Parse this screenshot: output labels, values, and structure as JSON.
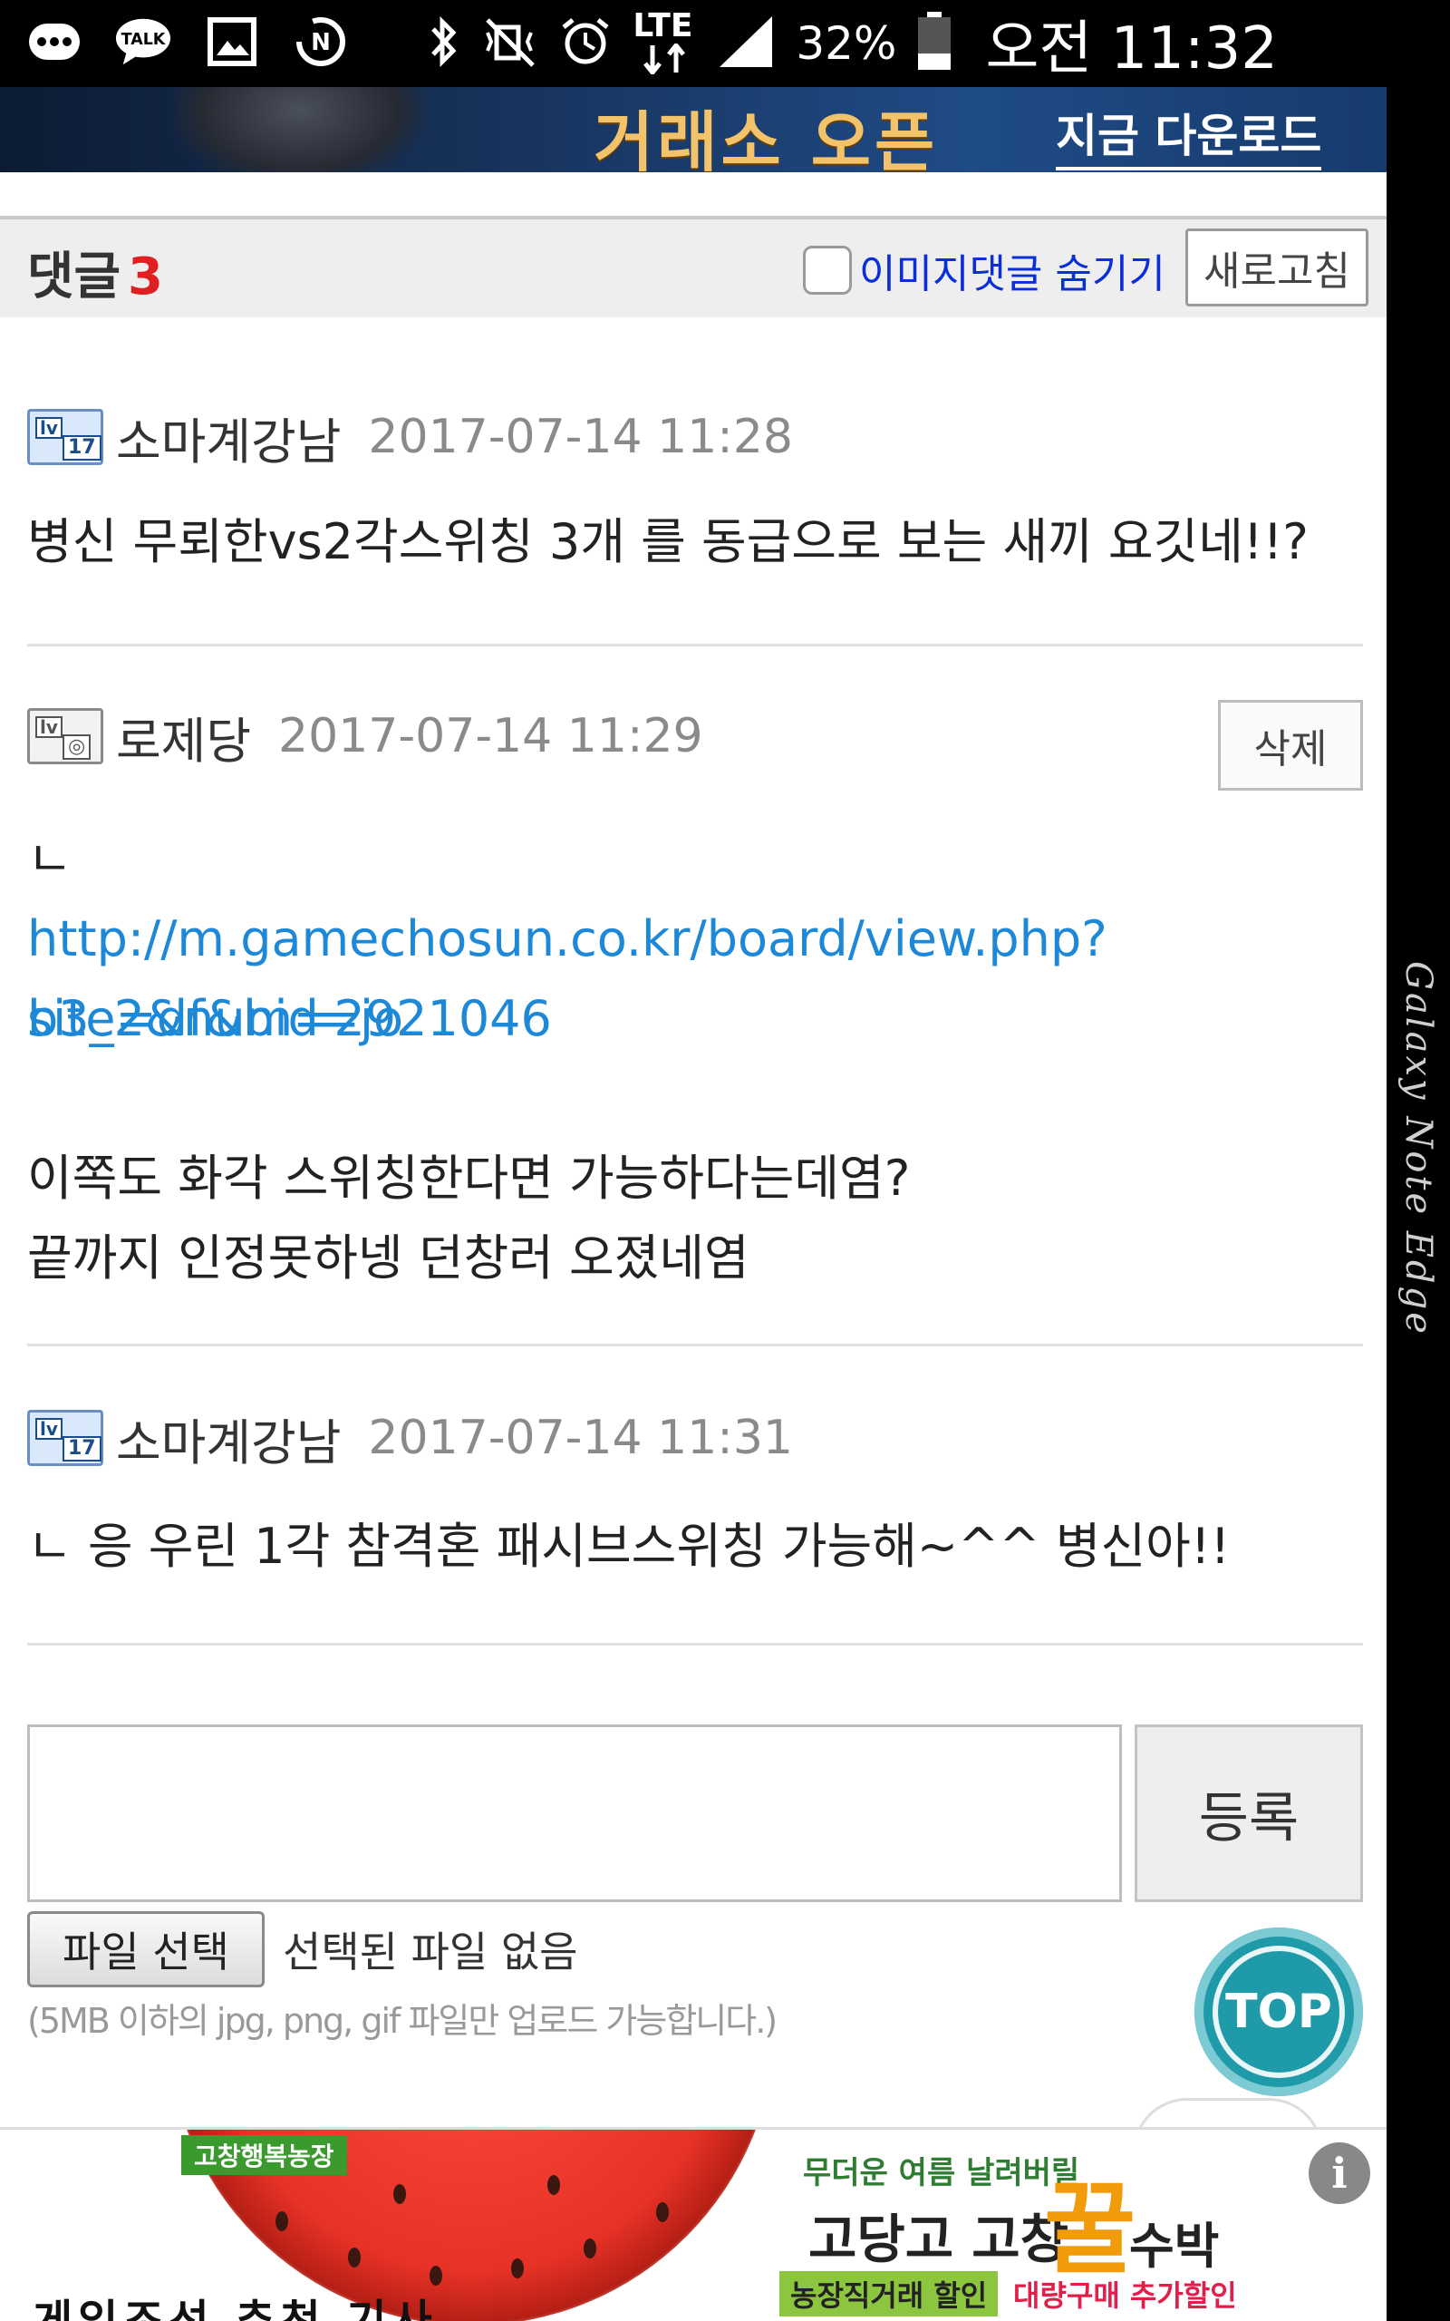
{
  "status_bar": {
    "icons": [
      "more-icon",
      "kakaotalk-icon",
      "gallery-icon",
      "naver-icon"
    ],
    "kakao_label": "TALK",
    "naver_label": "N",
    "network_label": "LTE",
    "battery_percent": "32%",
    "time": "오전 11:32"
  },
  "edge_label": "Galaxy Note Edge",
  "top_ad": {
    "title": "거래소 오픈",
    "cta": "지금 다운로드"
  },
  "comments_header": {
    "label": "댓글",
    "count": "3",
    "hide_images_label": "이미지댓글 숨기기",
    "hide_images_checked": false,
    "refresh_label": "새로고침"
  },
  "level_icon": {
    "a": "lv",
    "b1": "17",
    "b2": "◎"
  },
  "comments": [
    {
      "nickname": "소마계강남",
      "date": "2017-07-14 11:28",
      "lines": [
        "병신 무뢰한vs2각스위칭 3개 를 동급으로 보는 새끼 요깃네!!?"
      ]
    },
    {
      "nickname": "로제당",
      "date": "2017-07-14 11:29",
      "delete_label": "삭제",
      "line1": "ㄴ",
      "link_line1": "http://m.gamechosun.co.kr/board/view.php?site=df&bid=jo",
      "link_line2": "b3_2&num=2921046",
      "line2": "이쪽도 화각 스위칭한다면 가능하다는데염?",
      "line3": "끝까지 인정못하넹 던창러 오졌네염"
    },
    {
      "nickname": "소마계강남",
      "date": "2017-07-14 11:31",
      "lines": [
        "ㄴ 응 우린 1각 참격혼 패시브스위칭 가능해~^^ 병신아!!"
      ]
    }
  ],
  "write_form": {
    "textarea_value": "",
    "submit_label": "등록",
    "file_button_label": "파일 선택",
    "file_status": "선택된 파일 없음",
    "file_note": "(5MB 이하의 jpg, png, gif 파일만 업로드 가능합니다.)"
  },
  "top_button_label": "TOP",
  "bottom_ad": {
    "farm_tag": "고창행복농장",
    "copy1": "무더운 여름 날려버릴",
    "copy2": "고당고 고창",
    "honey": "꿀",
    "copy3": "수박",
    "copy4": "농장직거래 할인",
    "copy5": "대량구매 추가할인",
    "info_label": "i"
  },
  "bottom_peek_text": "게임조선 추천 기사"
}
